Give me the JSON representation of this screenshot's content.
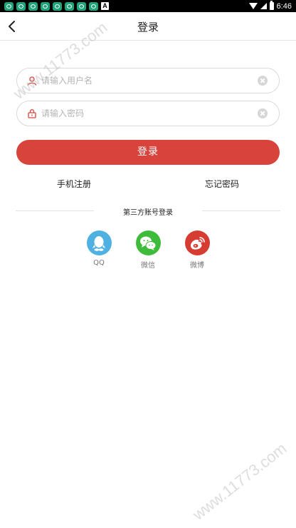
{
  "status_bar": {
    "notification_icons": [
      "app-notification-icon",
      "app-notification-icon",
      "app-notification-icon",
      "app-notification-icon",
      "app-notification-icon",
      "app-notification-icon",
      "app-notification-icon",
      "app-notification-icon"
    ],
    "a_badge": "A",
    "time": "6:46"
  },
  "header": {
    "title": "登录",
    "back_icon": "chevron-left-icon"
  },
  "form": {
    "username": {
      "placeholder": "请输入用户名",
      "value": "",
      "icon": "user-icon"
    },
    "password": {
      "placeholder": "请输入密码",
      "value": "",
      "icon": "lock-icon"
    },
    "login_label": "登录",
    "register_label": "手机注册",
    "forgot_label": "忘记密码"
  },
  "third_party": {
    "title": "第三方账号登录",
    "options": [
      {
        "label": "QQ",
        "icon": "qq-icon"
      },
      {
        "label": "微信",
        "icon": "wechat-icon"
      },
      {
        "label": "微博",
        "icon": "weibo-icon"
      }
    ]
  },
  "watermark": "www.11773.com",
  "colors": {
    "accent": "#d8443c",
    "qq": "#4fb0e2",
    "wechat": "#3ebb3a",
    "weibo": "#d63c32"
  }
}
